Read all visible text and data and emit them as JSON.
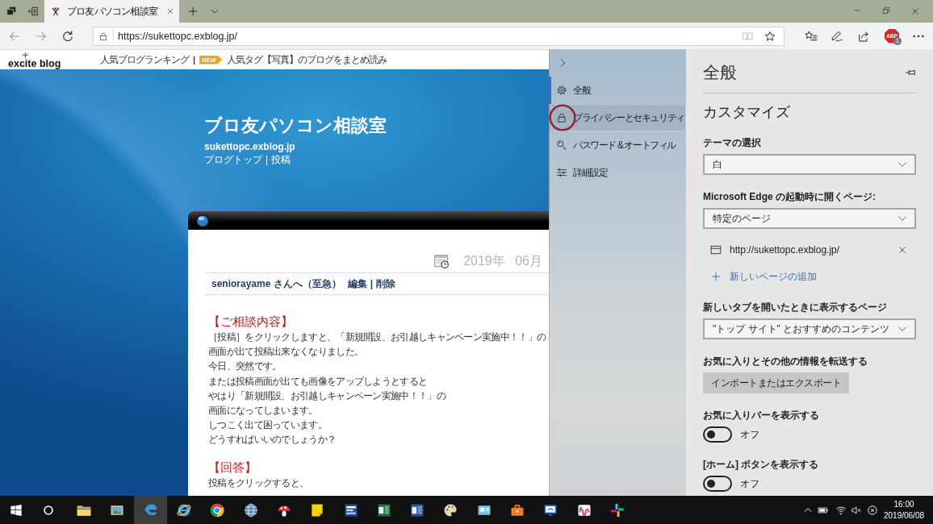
{
  "browser": {
    "tabs": [
      {
        "title": "ブロ友パソコン相談室",
        "selected": true
      }
    ],
    "address": "https://sukettopc.exblog.jp/",
    "extension": {
      "label": "ABP",
      "badge": "1"
    }
  },
  "blog": {
    "header": {
      "logo": "excite blog",
      "ranking_link": "人気ブログランキング",
      "separator": "|",
      "new_badge": "NEW",
      "tag_link": "人気タグ【写真】のブログをまとめ読み"
    },
    "title": "ブロ友パソコン相談室",
    "domain": "sukettopc.exblog.jp",
    "nav": [
      "ブログトップ",
      "投稿"
    ],
    "nav_separator": "|",
    "post": {
      "date": "2019年 06月",
      "heading": "seniorayame さんへ（至急）",
      "actions": [
        "編集",
        "削除"
      ],
      "action_separator": "|",
      "sections": [
        {
          "heading": "【ご相談内容】",
          "lines": [
            "［投稿］をクリックしますと、「新規開設、お引越しキャンペーン実施中！！」の",
            "画面が出て投稿出来なくなりました。",
            "今日、突然です。",
            "または投稿画面が出ても画像をアップしようとすると",
            "やはり「新規開設、お引越しキャンペーン実施中！！」の",
            "画面になってしまいます。",
            "しつこく出て困っています。",
            "どうすればいいのでしょうか？"
          ]
        },
        {
          "heading": "【回答】",
          "lines": [
            "投稿をクリックすると、"
          ]
        }
      ]
    }
  },
  "settings_nav": {
    "items": [
      {
        "label": "全般",
        "selected": true,
        "hovered": false,
        "circled": false
      },
      {
        "label": "プライバシーとセキュリティ",
        "selected": false,
        "hovered": true,
        "circled": true
      },
      {
        "label": "パスワード & オートフィル",
        "selected": false,
        "hovered": false,
        "circled": false
      },
      {
        "label": "詳細設定",
        "selected": false,
        "hovered": false,
        "circled": false
      }
    ]
  },
  "settings": {
    "title": "全般",
    "section": "カスタマイズ",
    "items": [
      {
        "kind": "select",
        "label": "テーマの選択",
        "value": "白"
      },
      {
        "kind": "select",
        "label": "Microsoft Edge の起動時に開くページ:",
        "value": "特定のページ"
      },
      {
        "kind": "page",
        "url": "http://sukettopc.exblog.jp/"
      },
      {
        "kind": "link",
        "label": "新しいページの追加"
      },
      {
        "kind": "select",
        "label": "新しいタブを開いたときに表示するページ",
        "value": "\"トップ サイト\" とおすすめのコンテンツ"
      },
      {
        "kind": "button",
        "label": "お気に入りとその他の情報を転送する",
        "button": "インポートまたはエクスポート"
      },
      {
        "kind": "toggle",
        "label": "お気に入りバーを表示する",
        "on": false,
        "state": "オフ"
      },
      {
        "kind": "toggle",
        "label": "[ホーム] ボタンを表示する",
        "on": false,
        "state": "オフ"
      }
    ]
  },
  "taskbar": {
    "apps": [
      {
        "active": false
      },
      {
        "active": false
      },
      {
        "active": true
      },
      {
        "active": false
      },
      {
        "active": false
      },
      {
        "active": false
      },
      {
        "active": false
      },
      {
        "active": false
      },
      {
        "active": false
      },
      {
        "active": false
      },
      {
        "active": false
      },
      {
        "active": false
      },
      {
        "active": false
      },
      {
        "active": false
      },
      {
        "active": false
      },
      {
        "active": false
      },
      {
        "active": false
      }
    ],
    "time": "16:00",
    "date": "2019/06/08"
  }
}
